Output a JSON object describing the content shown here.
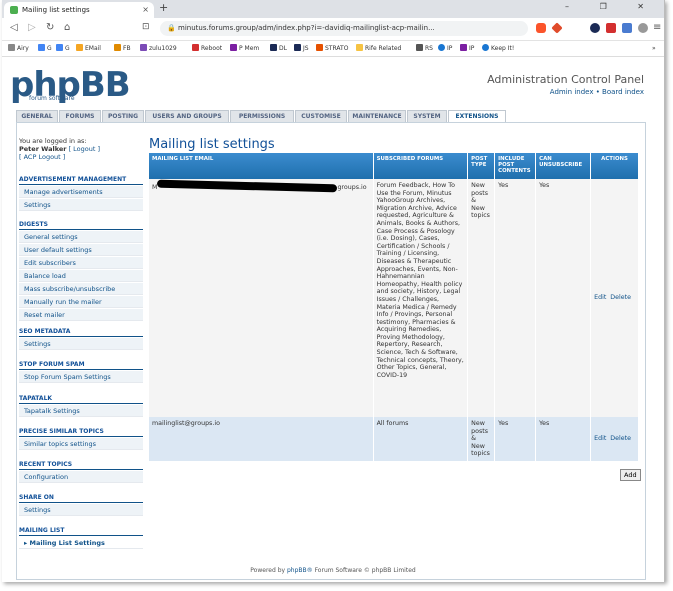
{
  "browser": {
    "tab_title": "Mailing list settings",
    "tab_close": "×",
    "new_tab": "+",
    "url": "minutus.forums.group/adm/index.php?i=-davidiq-mailinglist-acp-mailin...",
    "window_controls": "–  ❐  ✕"
  },
  "bookmarks": [
    "Airy",
    "G",
    "G",
    "EMail",
    "FB",
    "zulu1029",
    "Reboot",
    "P Mem",
    "DL",
    "JS",
    "STRATO",
    "Rife Related",
    "RS",
    "IP",
    "IP",
    "Keep It!"
  ],
  "acp": {
    "logo": "phpBB",
    "logo_sub": "forum  software",
    "title": "Administration Control Panel",
    "links": "Admin index • Board index"
  },
  "tabs": [
    "GENERAL",
    "FORUMS",
    "POSTING",
    "USERS AND GROUPS",
    "PERMISSIONS",
    "CUSTOMISE",
    "MAINTENANCE",
    "SYSTEM",
    "EXTENSIONS"
  ],
  "active_tab": "EXTENSIONS",
  "sidebar": {
    "logged_in_as": "You are logged in as:",
    "user": "Peter Walker",
    "logout": "[ Logout ]",
    "acp_logout": "[ ACP Logout ]",
    "sections": [
      {
        "title": "ADVERTISEMENT MANAGEMENT",
        "items": [
          "Manage advertisements",
          "Settings"
        ]
      },
      {
        "title": "DIGESTS",
        "items": [
          "General settings",
          "User default settings",
          "Edit subscribers",
          "Balance load",
          "Mass subscribe/unsubscribe",
          "Manually run the mailer",
          "Reset mailer"
        ]
      },
      {
        "title": "SEO METADATA",
        "items": [
          "Settings"
        ]
      },
      {
        "title": "STOP FORUM SPAM",
        "items": [
          "Stop Forum Spam Settings"
        ]
      },
      {
        "title": "TAPATALK",
        "items": [
          "Tapatalk Settings"
        ]
      },
      {
        "title": "PRECISE SIMILAR TOPICS",
        "items": [
          "Similar topics settings"
        ]
      },
      {
        "title": "RECENT TOPICS",
        "items": [
          "Configuration"
        ]
      },
      {
        "title": "SHARE ON",
        "items": [
          "Settings"
        ]
      },
      {
        "title": "MAILING LIST",
        "items": [
          "Mailing List Settings"
        ]
      }
    ]
  },
  "page": {
    "title": "Mailing list settings",
    "columns": [
      "MAILING LIST EMAIL",
      "SUBSCRIBED FORUMS",
      "POST TYPE",
      "INCLUDE POST CONTENTS",
      "CAN UNSUBSCRIBE",
      "ACTIONS"
    ],
    "rows": [
      {
        "email_prefix": "M",
        "email_suffix": "groups.io",
        "forums": "Forum Feedback, How To Use the Forum, Minutus YahooGroup Archives, Migration Archive, Advice requested, Agriculture & Animals, Books & Authors, Case Process & Posology (i.e. Dosing), Cases, Certification / Schools / Training / Licensing, Diseases & Therapeutic Approaches, Events, Non-Hahnemannian Homeopathy, Health policy and society, History, Legal Issues / Challenges, Materia Medica / Remedy Info / Provings, Personal testimony, Pharmacies & Acquiring Remedies, Proving Methodology, Repertory, Research, Science, Tech & Software, Technical concepts, Theory, Other Topics, General, COVID-19",
        "post_type": "New posts & New topics",
        "include_contents": "Yes",
        "can_unsubscribe": "Yes",
        "edit": "Edit",
        "delete": "Delete"
      },
      {
        "email": "mailinglist@groups.io",
        "forums": "All forums",
        "post_type": "New posts & New topics",
        "include_contents": "Yes",
        "can_unsubscribe": "Yes",
        "edit": "Edit",
        "delete": "Delete"
      }
    ],
    "add_button": "Add"
  },
  "footer": {
    "prefix": "Powered by",
    "link": "phpBB®",
    "suffix": "Forum Software © phpBB Limited"
  }
}
